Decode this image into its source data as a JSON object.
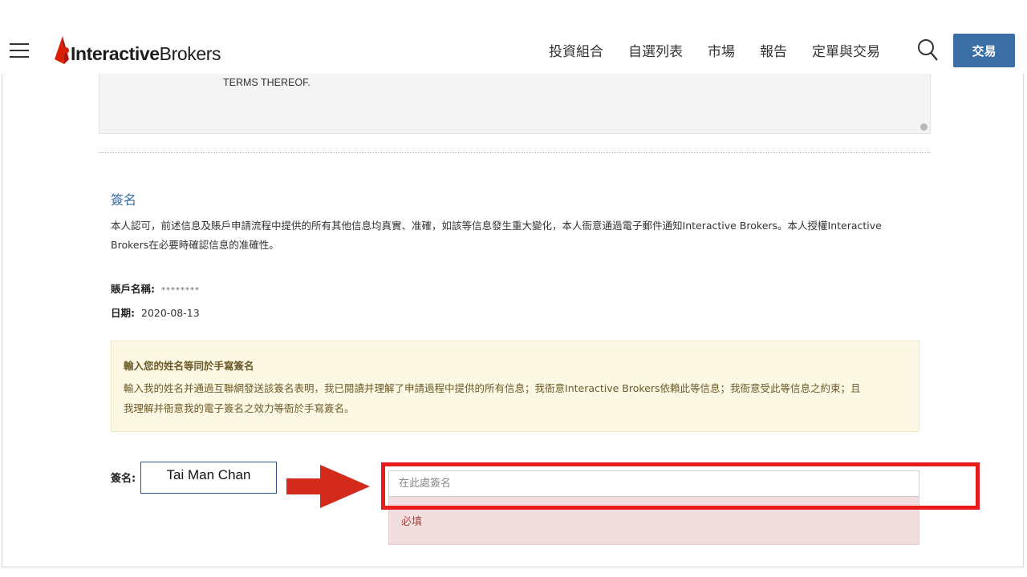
{
  "brand": {
    "name_bold": "Interactive",
    "name_regular": "Brokers"
  },
  "nav": {
    "links": [
      "投資組合",
      "自選列表",
      "市場",
      "報告",
      "定單與交易"
    ],
    "trade_label": "交易"
  },
  "terms": {
    "tail_text": "TERMS THEREOF."
  },
  "signature_section": {
    "title": "簽名",
    "statement_line1": "本人認可，前述信息及賬戶申請流程中提供的所有其他信息均真實、准確，如該等信息發生重大變化，本人衙意通過電子郵件通知Interactive Brokers。本人授權Interactive",
    "statement_line2": "Brokers在必要時確認信息的准確性。",
    "account_label": "賬戶名稱:",
    "account_value": "********",
    "date_label": "日期:",
    "date_value": "2020-08-13"
  },
  "notice": {
    "title": "輸入您的姓名等同於手寫簽名",
    "line1": "輸入我的姓名并通過互聯網發送該簽名表明，我已閱讀并理解了申請過程中提供的所有信息；我衙意Interactive Brokers依賴此等信息；我衙意受此等信息之約束；且",
    "line2": "我理解并衙意我的電子簽名之效力等衙於手寫簽名。"
  },
  "signature_input": {
    "label": "簽名:",
    "annotation_name": "Tai Man Chan",
    "placeholder": "在此處簽名",
    "value": "",
    "error": "必填"
  },
  "colors": {
    "accent": "#3a6ea5",
    "highlight": "#e81c1c",
    "arrow": "#d42a1c",
    "notice_bg": "#fcf8e3",
    "error_bg": "#f2dede"
  },
  "icons": [
    "hamburger-icon",
    "ib-logo-icon",
    "search-icon",
    "arrow-right-icon"
  ]
}
